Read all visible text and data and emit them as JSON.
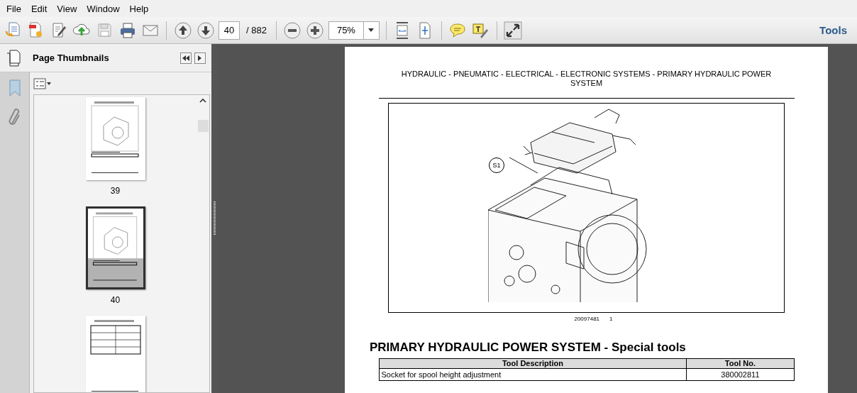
{
  "menu": [
    "File",
    "Edit",
    "View",
    "Window",
    "Help"
  ],
  "toolbar": {
    "page_field": "40",
    "page_total": "/ 882",
    "zoom_field": "75%",
    "tools_label": "Tools"
  },
  "sidebar": {
    "title": "Page Thumbnails",
    "thumbnails": [
      {
        "label": "39",
        "selected": false
      },
      {
        "label": "40",
        "selected": true
      },
      {
        "selected": false
      }
    ]
  },
  "document": {
    "header": "HYDRAULIC - PNEUMATIC - ELECTRICAL - ELECTRONIC SYSTEMS - PRIMARY HYDRAULIC POWER SYSTEM",
    "figure": {
      "callout": "S1",
      "figure_id": "20097481",
      "figure_number": "1"
    },
    "section_title": "PRIMARY HYDRAULIC POWER SYSTEM - Special tools",
    "table": {
      "columns": [
        "Tool Description",
        "Tool No."
      ],
      "rows": [
        [
          "Socket for spool height adjustment",
          "380002811"
        ]
      ]
    }
  }
}
